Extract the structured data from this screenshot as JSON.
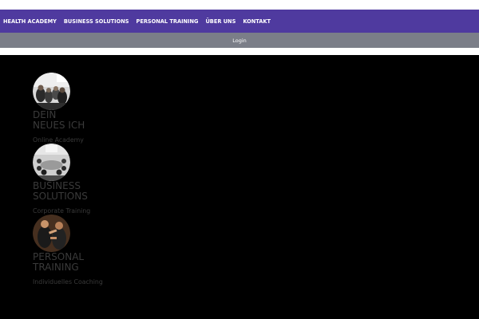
{
  "nav": {
    "items": [
      {
        "label": "HEALTH ACADEMY"
      },
      {
        "label": "BUSINESS SOLUTIONS"
      },
      {
        "label": "PERSONAL TRAINING"
      },
      {
        "label": "ÜBER UNS"
      },
      {
        "label": "KONTAKT"
      }
    ],
    "bg_color": "#4f3a9f"
  },
  "loginbar": {
    "label": "Login",
    "bg_color": "#7b7e88"
  },
  "cards": [
    {
      "title_lines": [
        "DEIN",
        "NEUES ICH"
      ],
      "subtitle": "Online Academy",
      "image": "seminar-audience-photo"
    },
    {
      "title_lines": [
        "BUSINESS",
        "SOLUTIONS"
      ],
      "subtitle": "Corporate Training",
      "image": "conference-room-photo"
    },
    {
      "title_lines": [
        "PERSONAL",
        "TRAINING"
      ],
      "subtitle": "Individuelles Coaching",
      "image": "personal-trainer-photo"
    }
  ]
}
